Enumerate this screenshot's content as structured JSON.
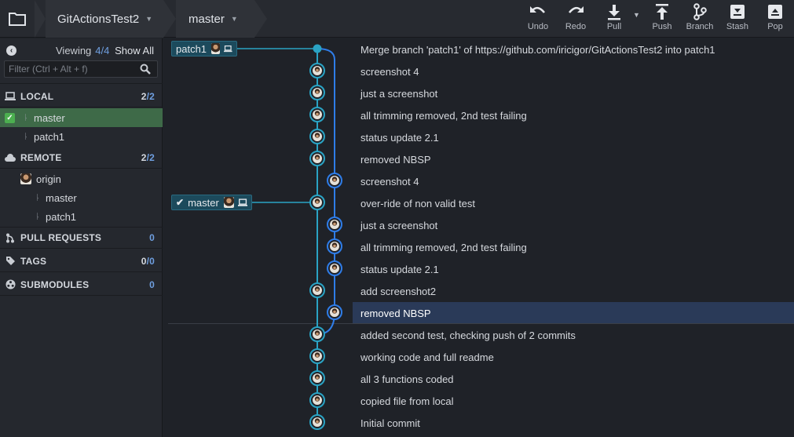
{
  "app": {
    "repo_name": "GitActionsTest2",
    "branch_name": "master"
  },
  "toolbar": [
    {
      "label": "Undo",
      "icon": "undo-icon"
    },
    {
      "label": "Redo",
      "icon": "redo-icon"
    },
    {
      "label": "Pull",
      "icon": "pull-icon"
    },
    {
      "label": "Push",
      "icon": "push-icon"
    },
    {
      "label": "Branch",
      "icon": "branch-icon"
    },
    {
      "label": "Stash",
      "icon": "stash-icon"
    },
    {
      "label": "Pop",
      "icon": "pop-icon"
    }
  ],
  "sidebar": {
    "viewing_label": "Viewing",
    "viewing_count": "4",
    "viewing_total": "/4",
    "show_all": "Show All",
    "filter_placeholder": "Filter (Ctrl + Alt + f)",
    "local": {
      "title": "LOCAL",
      "count": "2",
      "total": "/2",
      "branches": [
        "master",
        "patch1"
      ]
    },
    "remote": {
      "title": "REMOTE",
      "count": "2",
      "total": "/2",
      "origin": "origin",
      "branches": [
        "master",
        "patch1"
      ]
    },
    "pull_requests": {
      "title": "PULL REQUESTS",
      "count": "0"
    },
    "tags": {
      "title": "TAGS",
      "count": "0",
      "total": "/0"
    },
    "submodules": {
      "title": "SUBMODULES",
      "count": "0"
    }
  },
  "graph": {
    "badges": [
      "patch1",
      "master"
    ],
    "commits": [
      "Merge branch 'patch1' of https://github.com/iricigor/GitActionsTest2 into patch1",
      "screenshot 4",
      "just a screenshot",
      "all trimming removed, 2nd test failing",
      "status update 2.1",
      "removed NBSP",
      "screenshot 4",
      "over-ride of non valid test",
      "just a screenshot",
      "all trimming removed, 2nd test failing",
      "status update 2.1",
      "add screenshot2",
      "removed NBSP",
      "added second test, checking push of 2 commits",
      "working code and full readme",
      "all 3 functions coded",
      "copied file from local",
      "Initial commit"
    ],
    "selected_index": 12
  },
  "colors": {
    "lane1": "#2aa3c4",
    "lane2": "#2f7de8",
    "selected": "#2a3a58"
  }
}
